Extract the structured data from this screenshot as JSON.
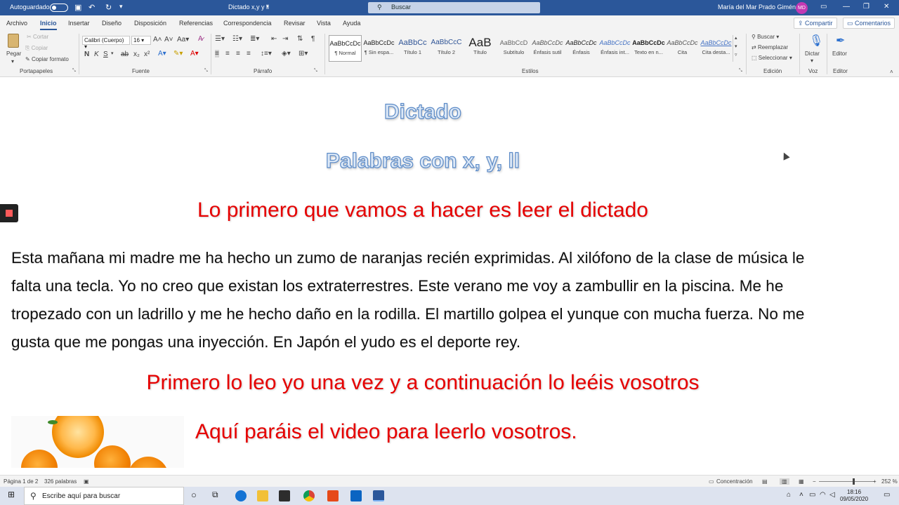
{
  "titlebar": {
    "autosave": "Autoguardado",
    "doc_title": "Dictado x,y y ll",
    "search": "Buscar",
    "user": "María del Mar Prado Giménez",
    "avatar": "MD"
  },
  "menu": {
    "tabs": [
      "Archivo",
      "Inicio",
      "Insertar",
      "Diseño",
      "Disposición",
      "Referencias",
      "Correspondencia",
      "Revisar",
      "Vista",
      "Ayuda"
    ],
    "active": "Inicio",
    "share": "Compartir",
    "comments": "Comentarios"
  },
  "ribbon": {
    "clipboard": {
      "paste": "Pegar",
      "cut": "Cortar",
      "copy": "Copiar",
      "format_painter": "Copiar formato",
      "label": "Portapapeles"
    },
    "font": {
      "name": "Calibri (Cuerpo)",
      "size": "16",
      "label": "Fuente",
      "case": "Aa"
    },
    "paragraph": {
      "label": "Párrafo"
    },
    "styles": {
      "items": [
        {
          "preview": "AaBbCcDc",
          "name": "¶ Normal"
        },
        {
          "preview": "AaBbCcDc",
          "name": "¶ Sin espa..."
        },
        {
          "preview": "AaBbCc",
          "name": "Título 1"
        },
        {
          "preview": "AaBbCcC",
          "name": "Título 2"
        },
        {
          "preview": "AaB",
          "name": "Título"
        },
        {
          "preview": "AaBbCcD",
          "name": "Subtítulo"
        },
        {
          "preview": "AaBbCcDc",
          "name": "Énfasis sutil"
        },
        {
          "preview": "AaBbCcDc",
          "name": "Énfasis"
        },
        {
          "preview": "AaBbCcDc",
          "name": "Énfasis int..."
        },
        {
          "preview": "AaBbCcDc",
          "name": "Texto en n..."
        },
        {
          "preview": "AaBbCcDc",
          "name": "Cita"
        },
        {
          "preview": "AaBbCcDc",
          "name": "Cita desta..."
        }
      ],
      "label": "Estilos"
    },
    "editing": {
      "find": "Buscar",
      "replace": "Reemplazar",
      "select": "Seleccionar",
      "label": "Edición"
    },
    "voice": {
      "dictate": "Dictar",
      "label": "Voz"
    },
    "editor": {
      "editor": "Editor",
      "label": "Editor"
    }
  },
  "document": {
    "title": "Dictado",
    "subtitle": "Palabras con x, y, ll",
    "heading1": "Lo primero que vamos a hacer es leer el dictado",
    "paragraph": "Esta mañana mi madre me ha hecho un zumo de naranjas recién exprimidas. Al xilófono de la clase de música le falta una tecla. Yo no creo que existan los extraterrestres. Este verano me voy a zambullir en la piscina. Me he tropezado con un ladrillo y me he hecho daño en la rodilla. El martillo golpea el yunque con mucha fuerza. No me gusta que me pongas una inyección. En Japón el yudo es el deporte rey.",
    "heading2": "Primero lo leo yo una vez y a continuación lo leéis vosotros",
    "heading3": "Aquí paráis el video para leerlo vosotros."
  },
  "status": {
    "page": "Página 1 de 2",
    "words": "326 palabras",
    "focus": "Concentración",
    "zoom": "252 %"
  },
  "taskbar": {
    "search": "Escribe aquí para buscar",
    "time": "18:16",
    "date": "09/05/2020"
  },
  "colors": {
    "titlebar": "#2b579a",
    "heading_red": "#e60000",
    "outline_blue": "#5b8ac7"
  }
}
